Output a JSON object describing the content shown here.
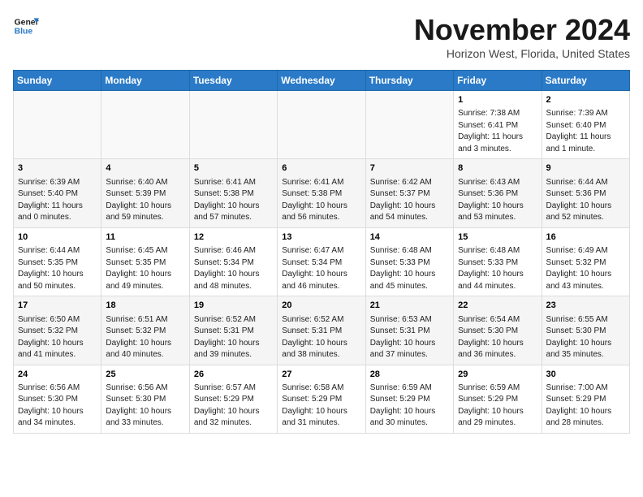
{
  "header": {
    "logo_line1": "General",
    "logo_line2": "Blue",
    "month_year": "November 2024",
    "subtitle": "Horizon West, Florida, United States"
  },
  "weekdays": [
    "Sunday",
    "Monday",
    "Tuesday",
    "Wednesday",
    "Thursday",
    "Friday",
    "Saturday"
  ],
  "weeks": [
    [
      {
        "day": "",
        "empty": true
      },
      {
        "day": "",
        "empty": true
      },
      {
        "day": "",
        "empty": true
      },
      {
        "day": "",
        "empty": true
      },
      {
        "day": "",
        "empty": true
      },
      {
        "day": "1",
        "sunrise": "Sunrise: 7:38 AM",
        "sunset": "Sunset: 6:41 PM",
        "daylight": "Daylight: 11 hours and 3 minutes."
      },
      {
        "day": "2",
        "sunrise": "Sunrise: 7:39 AM",
        "sunset": "Sunset: 6:40 PM",
        "daylight": "Daylight: 11 hours and 1 minute."
      }
    ],
    [
      {
        "day": "3",
        "sunrise": "Sunrise: 6:39 AM",
        "sunset": "Sunset: 5:40 PM",
        "daylight": "Daylight: 11 hours and 0 minutes."
      },
      {
        "day": "4",
        "sunrise": "Sunrise: 6:40 AM",
        "sunset": "Sunset: 5:39 PM",
        "daylight": "Daylight: 10 hours and 59 minutes."
      },
      {
        "day": "5",
        "sunrise": "Sunrise: 6:41 AM",
        "sunset": "Sunset: 5:38 PM",
        "daylight": "Daylight: 10 hours and 57 minutes."
      },
      {
        "day": "6",
        "sunrise": "Sunrise: 6:41 AM",
        "sunset": "Sunset: 5:38 PM",
        "daylight": "Daylight: 10 hours and 56 minutes."
      },
      {
        "day": "7",
        "sunrise": "Sunrise: 6:42 AM",
        "sunset": "Sunset: 5:37 PM",
        "daylight": "Daylight: 10 hours and 54 minutes."
      },
      {
        "day": "8",
        "sunrise": "Sunrise: 6:43 AM",
        "sunset": "Sunset: 5:36 PM",
        "daylight": "Daylight: 10 hours and 53 minutes."
      },
      {
        "day": "9",
        "sunrise": "Sunrise: 6:44 AM",
        "sunset": "Sunset: 5:36 PM",
        "daylight": "Daylight: 10 hours and 52 minutes."
      }
    ],
    [
      {
        "day": "10",
        "sunrise": "Sunrise: 6:44 AM",
        "sunset": "Sunset: 5:35 PM",
        "daylight": "Daylight: 10 hours and 50 minutes."
      },
      {
        "day": "11",
        "sunrise": "Sunrise: 6:45 AM",
        "sunset": "Sunset: 5:35 PM",
        "daylight": "Daylight: 10 hours and 49 minutes."
      },
      {
        "day": "12",
        "sunrise": "Sunrise: 6:46 AM",
        "sunset": "Sunset: 5:34 PM",
        "daylight": "Daylight: 10 hours and 48 minutes."
      },
      {
        "day": "13",
        "sunrise": "Sunrise: 6:47 AM",
        "sunset": "Sunset: 5:34 PM",
        "daylight": "Daylight: 10 hours and 46 minutes."
      },
      {
        "day": "14",
        "sunrise": "Sunrise: 6:48 AM",
        "sunset": "Sunset: 5:33 PM",
        "daylight": "Daylight: 10 hours and 45 minutes."
      },
      {
        "day": "15",
        "sunrise": "Sunrise: 6:48 AM",
        "sunset": "Sunset: 5:33 PM",
        "daylight": "Daylight: 10 hours and 44 minutes."
      },
      {
        "day": "16",
        "sunrise": "Sunrise: 6:49 AM",
        "sunset": "Sunset: 5:32 PM",
        "daylight": "Daylight: 10 hours and 43 minutes."
      }
    ],
    [
      {
        "day": "17",
        "sunrise": "Sunrise: 6:50 AM",
        "sunset": "Sunset: 5:32 PM",
        "daylight": "Daylight: 10 hours and 41 minutes."
      },
      {
        "day": "18",
        "sunrise": "Sunrise: 6:51 AM",
        "sunset": "Sunset: 5:32 PM",
        "daylight": "Daylight: 10 hours and 40 minutes."
      },
      {
        "day": "19",
        "sunrise": "Sunrise: 6:52 AM",
        "sunset": "Sunset: 5:31 PM",
        "daylight": "Daylight: 10 hours and 39 minutes."
      },
      {
        "day": "20",
        "sunrise": "Sunrise: 6:52 AM",
        "sunset": "Sunset: 5:31 PM",
        "daylight": "Daylight: 10 hours and 38 minutes."
      },
      {
        "day": "21",
        "sunrise": "Sunrise: 6:53 AM",
        "sunset": "Sunset: 5:31 PM",
        "daylight": "Daylight: 10 hours and 37 minutes."
      },
      {
        "day": "22",
        "sunrise": "Sunrise: 6:54 AM",
        "sunset": "Sunset: 5:30 PM",
        "daylight": "Daylight: 10 hours and 36 minutes."
      },
      {
        "day": "23",
        "sunrise": "Sunrise: 6:55 AM",
        "sunset": "Sunset: 5:30 PM",
        "daylight": "Daylight: 10 hours and 35 minutes."
      }
    ],
    [
      {
        "day": "24",
        "sunrise": "Sunrise: 6:56 AM",
        "sunset": "Sunset: 5:30 PM",
        "daylight": "Daylight: 10 hours and 34 minutes."
      },
      {
        "day": "25",
        "sunrise": "Sunrise: 6:56 AM",
        "sunset": "Sunset: 5:30 PM",
        "daylight": "Daylight: 10 hours and 33 minutes."
      },
      {
        "day": "26",
        "sunrise": "Sunrise: 6:57 AM",
        "sunset": "Sunset: 5:29 PM",
        "daylight": "Daylight: 10 hours and 32 minutes."
      },
      {
        "day": "27",
        "sunrise": "Sunrise: 6:58 AM",
        "sunset": "Sunset: 5:29 PM",
        "daylight": "Daylight: 10 hours and 31 minutes."
      },
      {
        "day": "28",
        "sunrise": "Sunrise: 6:59 AM",
        "sunset": "Sunset: 5:29 PM",
        "daylight": "Daylight: 10 hours and 30 minutes."
      },
      {
        "day": "29",
        "sunrise": "Sunrise: 6:59 AM",
        "sunset": "Sunset: 5:29 PM",
        "daylight": "Daylight: 10 hours and 29 minutes."
      },
      {
        "day": "30",
        "sunrise": "Sunrise: 7:00 AM",
        "sunset": "Sunset: 5:29 PM",
        "daylight": "Daylight: 10 hours and 28 minutes."
      }
    ]
  ]
}
